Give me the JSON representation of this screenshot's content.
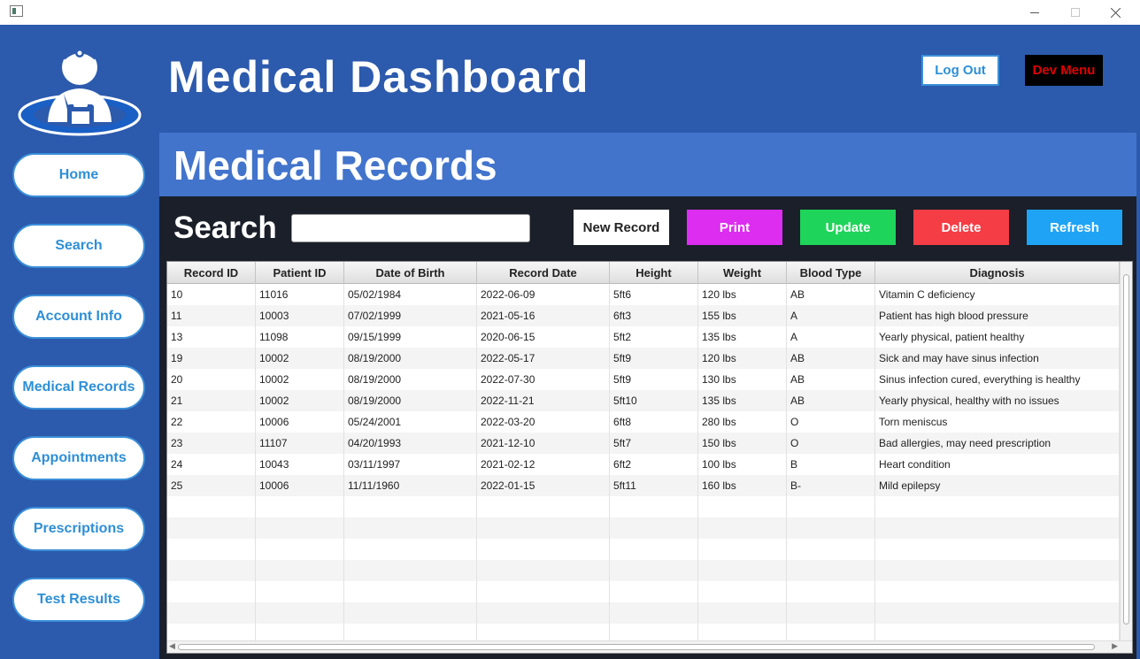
{
  "app": {
    "title": "Medical Dashboard",
    "logout_label": "Log Out",
    "dev_menu_label": "Dev Menu"
  },
  "sidebar": {
    "items": [
      {
        "label": "Home"
      },
      {
        "label": "Search"
      },
      {
        "label": "Account Info"
      },
      {
        "label": "Medical Records"
      },
      {
        "label": "Appointments"
      },
      {
        "label": "Prescriptions"
      },
      {
        "label": "Test Results"
      }
    ]
  },
  "section": {
    "title": "Medical Records"
  },
  "toolbar": {
    "search_label": "Search",
    "search_value": "",
    "buttons": [
      {
        "label": "New Record",
        "color": "#ffffff",
        "text_color": "#222222"
      },
      {
        "label": "Print",
        "color": "#dd2df0",
        "text_color": "#ffffff"
      },
      {
        "label": "Update",
        "color": "#1fd45a",
        "text_color": "#ffffff"
      },
      {
        "label": "Delete",
        "color": "#f43d44",
        "text_color": "#ffffff"
      },
      {
        "label": "Refresh",
        "color": "#1fa4f5",
        "text_color": "#ffffff"
      }
    ]
  },
  "table": {
    "columns": [
      "Record ID",
      "Patient ID",
      "Date of Birth",
      "Record Date",
      "Height",
      "Weight",
      "Blood Type",
      "Diagnosis"
    ],
    "rows": [
      [
        "10",
        "11016",
        "05/02/1984",
        "2022-06-09",
        "5ft6",
        "120 lbs",
        "AB",
        "Vitamin C deficiency"
      ],
      [
        "11",
        "10003",
        "07/02/1999",
        "2021-05-16",
        "6ft3",
        "155 lbs",
        "A",
        "Patient has high blood pressure"
      ],
      [
        "13",
        "11098",
        "09/15/1999",
        "2020-06-15",
        "5ft2",
        "135 lbs",
        "A",
        "Yearly physical, patient healthy"
      ],
      [
        "19",
        "10002",
        "08/19/2000",
        "2022-05-17",
        "5ft9",
        "120 lbs",
        "AB",
        "Sick and may have sinus infection"
      ],
      [
        "20",
        "10002",
        "08/19/2000",
        "2022-07-30",
        "5ft9",
        "130 lbs",
        "AB",
        "Sinus infection cured, everything is healthy"
      ],
      [
        "21",
        "10002",
        "08/19/2000",
        "2022-11-21",
        "5ft10",
        "135 lbs",
        "AB",
        "Yearly physical, healthy with no issues"
      ],
      [
        "22",
        "10006",
        "05/24/2001",
        "2022-03-20",
        "6ft8",
        "280 lbs",
        "O",
        "Torn meniscus"
      ],
      [
        "23",
        "11107",
        "04/20/1993",
        "2021-12-10",
        "5ft7",
        "150 lbs",
        "O",
        "Bad allergies, may need prescription"
      ],
      [
        "24",
        "10043",
        "03/11/1997",
        "2021-02-12",
        "6ft2",
        "100 lbs",
        "B",
        "Heart condition"
      ],
      [
        "25",
        "10006",
        "11/11/1960",
        "2022-01-15",
        "5ft11",
        "160 lbs",
        "B-",
        "Mild epilepsy"
      ]
    ]
  },
  "colors": {
    "background": "#2c5aad",
    "section_bar": "#4274cc",
    "main_panel": "#1a1f29",
    "nav_text": "#2e8fd6",
    "dev_menu_text": "#e00000"
  }
}
